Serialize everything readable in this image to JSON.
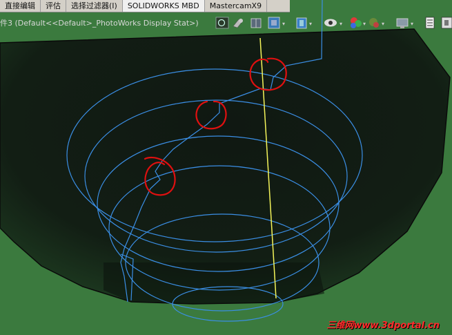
{
  "tabs": [
    {
      "label": "直接编辑",
      "active": false
    },
    {
      "label": "评估",
      "active": false
    },
    {
      "label": "选择过滤器(I)",
      "active": false
    },
    {
      "label": "SOLIDWORKS MBD",
      "active": true
    },
    {
      "label": "MastercamX9",
      "active": false
    }
  ],
  "document": {
    "title": "件3  (Default<<Default>_PhotoWorks Display Stat>)"
  },
  "toolbar": {
    "icons": [
      "zoom-to-fit-icon",
      "zoom-area-icon",
      "view-orientation-icon",
      "section-view-icon",
      "display-style-icon",
      "hide-show-items-icon",
      "edit-appearance-icon",
      "apply-scene-icon",
      "view-settings-icon",
      "task-pane-icon"
    ]
  },
  "colors": {
    "background_green": "#3b7a3e",
    "model_dark": "#0a0f0a",
    "curve_blue": "#3b8fe6",
    "axis_yellow": "#f5f55a",
    "annotation_red": "#e01010"
  },
  "watermark": {
    "text": "三维网www.3dportal.cn"
  }
}
